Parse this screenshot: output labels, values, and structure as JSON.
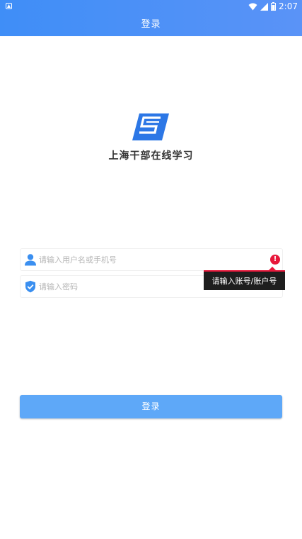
{
  "status_bar": {
    "time": "2:07",
    "icons": [
      "notification-icon",
      "wifi-icon",
      "signal-icon",
      "battery-icon"
    ]
  },
  "header": {
    "title": "登录"
  },
  "brand": {
    "logo": "app-logo",
    "name": "上海干部在线学习",
    "logo_color": "#2c77e6"
  },
  "form": {
    "username": {
      "value": "",
      "placeholder": "请输入用户名或手机号",
      "icon": "user-icon"
    },
    "password": {
      "value": "",
      "placeholder": "请输入密码",
      "icon": "shield-check-icon"
    },
    "error": {
      "icon": "error-icon",
      "glyph": "!",
      "message": "请输入账号/账户号",
      "color": "#e8173a"
    },
    "submit_label": "登录"
  },
  "colors": {
    "header": "#4a90f7",
    "button": "#5ea8f8",
    "icon_blue": "#3a8ff0"
  }
}
